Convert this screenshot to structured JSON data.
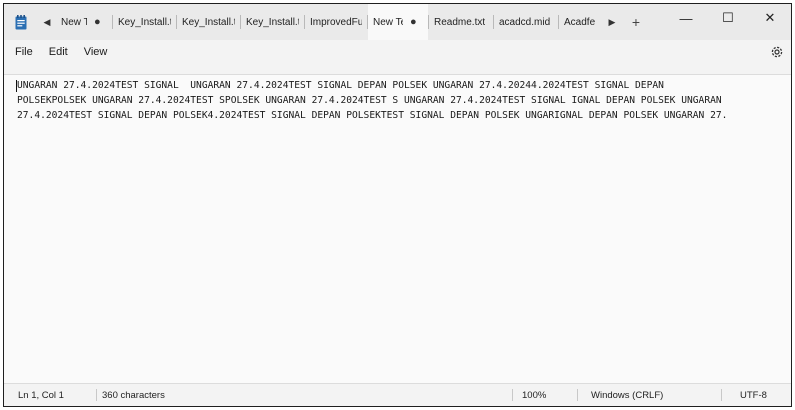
{
  "window": {
    "tabs": [
      {
        "label": "New Te",
        "modified": true
      },
      {
        "label": "Key_Install.tx",
        "modified": false
      },
      {
        "label": "Key_Install.tx",
        "modified": false
      },
      {
        "label": "Key_Install.tx",
        "modified": false
      },
      {
        "label": "ImprovedFu",
        "modified": false
      },
      {
        "label": "New Te",
        "modified": true
      },
      {
        "label": "Readme.txt",
        "modified": false
      },
      {
        "label": "acadcd.mid",
        "modified": false
      },
      {
        "label": "Acadfe",
        "modified": false
      }
    ],
    "tab_modified_glyph": "●",
    "scroll_left_glyph": "◀",
    "scroll_right_glyph": "▶",
    "new_tab_glyph": "+",
    "minimize_glyph": "—",
    "maximize_glyph": "☐",
    "close_glyph": "✕"
  },
  "menu": {
    "file": "File",
    "edit": "Edit",
    "view": "View"
  },
  "editor": {
    "lines": [
      "UNGARAN 27.4.2024TEST SIGNAL  UNGARAN 27.4.2024TEST SIGNAL DEPAN POLSEK UNGARAN 27.4.20244.2024TEST SIGNAL DEPAN",
      "POLSEKPOLSEK UNGARAN 27.4.2024TEST SPOLSEK UNGARAN 27.4.2024TEST S UNGARAN 27.4.2024TEST SIGNAL IGNAL DEPAN POLSEK UNGARAN",
      "27.4.2024TEST SIGNAL DEPAN POLSEK4.2024TEST SIGNAL DEPAN POLSEKTEST SIGNAL DEPAN POLSEK UNGARIGNAL DEPAN POLSEK UNGARAN 27."
    ]
  },
  "status": {
    "position": "Ln 1, Col 1",
    "characters": "360 characters",
    "zoom": "100%",
    "line_ending": "Windows (CRLF)",
    "encoding": "UTF-8"
  },
  "colors": {
    "titlebar": "#eaeaea",
    "editor_bg": "#fafafa",
    "app_icon": "#2b6fb3"
  },
  "icons": {
    "app": "notepad-icon",
    "settings": "gear-icon"
  }
}
